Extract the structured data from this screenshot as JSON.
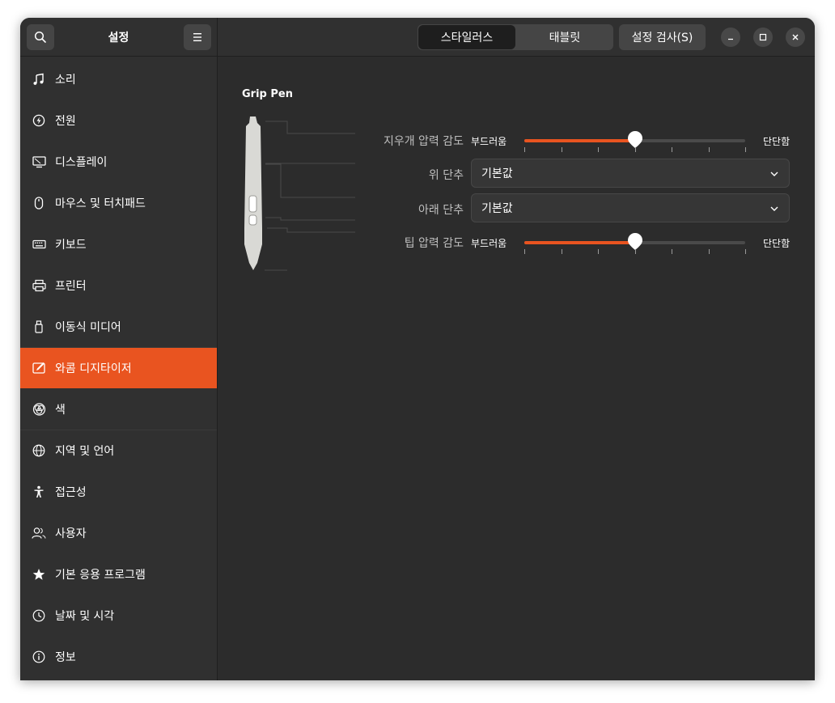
{
  "header": {
    "title": "설정",
    "tabs": [
      {
        "label": "스타일러스",
        "active": true
      },
      {
        "label": "태블릿",
        "active": false
      }
    ],
    "test_button_label": "설정 검사(S)"
  },
  "sidebar": {
    "items": [
      {
        "label": "소리",
        "icon": "music-note-icon"
      },
      {
        "label": "전원",
        "icon": "power-icon"
      },
      {
        "label": "디스플레이",
        "icon": "display-icon"
      },
      {
        "label": "마우스 및 터치패드",
        "icon": "mouse-icon"
      },
      {
        "label": "키보드",
        "icon": "keyboard-icon"
      },
      {
        "label": "프린터",
        "icon": "printer-icon"
      },
      {
        "label": "이동식 미디어",
        "icon": "usb-drive-icon"
      },
      {
        "label": "와콤 디지타이저",
        "icon": "tablet-pen-icon",
        "active": true
      },
      {
        "label": "색",
        "icon": "color-icon"
      },
      {
        "label": "지역 및 언어",
        "icon": "globe-icon"
      },
      {
        "label": "접근성",
        "icon": "accessibility-icon"
      },
      {
        "label": "사용자",
        "icon": "users-icon"
      },
      {
        "label": "기본 응용 프로그램",
        "icon": "star-icon"
      },
      {
        "label": "날짜 및 시각",
        "icon": "clock-icon"
      },
      {
        "label": "정보",
        "icon": "info-icon"
      }
    ]
  },
  "stylus": {
    "name": "Grip Pen",
    "eraser_pressure": {
      "label": "지우개 압력 감도",
      "min_label": "부드러움",
      "max_label": "단단함",
      "value": 0.5
    },
    "top_button": {
      "label": "위 단추",
      "value": "기본값"
    },
    "bottom_button": {
      "label": "아래 단추",
      "value": "기본값"
    },
    "tip_pressure": {
      "label": "팁 압력 감도",
      "min_label": "부드러움",
      "max_label": "단단함",
      "value": 0.5
    }
  },
  "colors": {
    "accent": "#e95420",
    "background": "#2c2c2c",
    "sidebar": "#303030"
  }
}
